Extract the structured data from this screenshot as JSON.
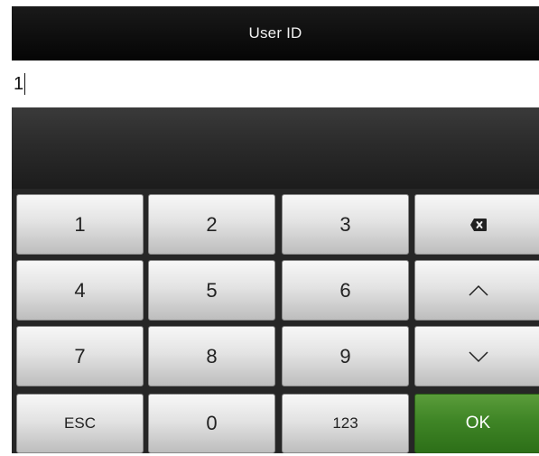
{
  "header": {
    "title": "User ID"
  },
  "input": {
    "value": "1"
  },
  "keypad": {
    "rows": [
      [
        "1",
        "2",
        "3"
      ],
      [
        "4",
        "5",
        "6"
      ],
      [
        "7",
        "8",
        "9"
      ]
    ],
    "esc_label": "ESC",
    "zero_label": "0",
    "mode_label": "123",
    "ok_label": "OK",
    "backspace_icon": "backspace-icon",
    "up_icon": "chevron-up-icon",
    "down_icon": "chevron-down-icon",
    "ok_color": "#3f8526"
  }
}
